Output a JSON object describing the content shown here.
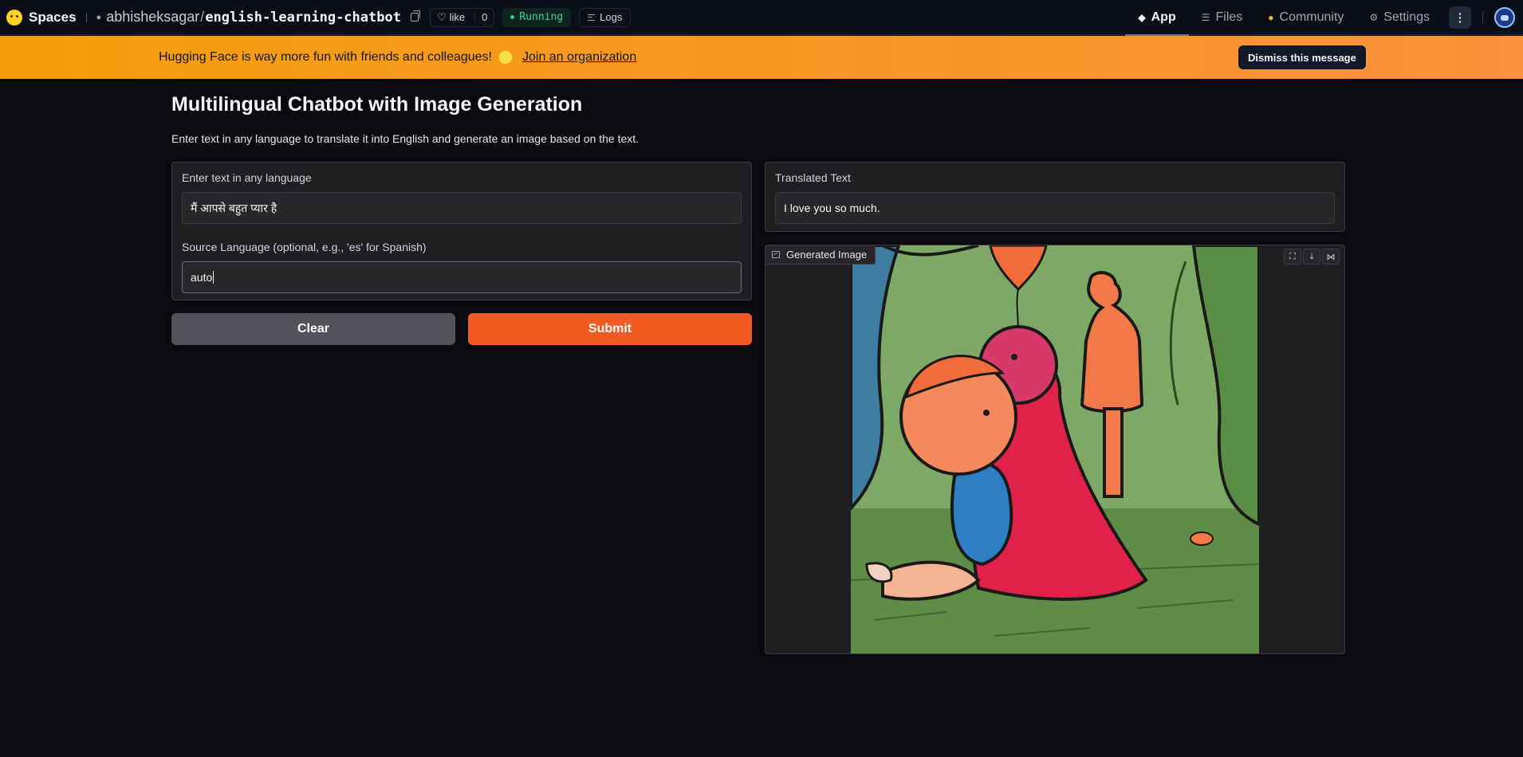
{
  "topnav": {
    "brand": "Spaces",
    "owner": "abhisheksagar",
    "slash": "/",
    "repo_name": "english-learning-chatbot",
    "like_label": "like",
    "like_count": "0",
    "status": "Running",
    "logs_label": "Logs",
    "tabs": [
      {
        "label": "App",
        "icon": "app-cube-icon",
        "active": true
      },
      {
        "label": "Files",
        "icon": "files-icon",
        "active": false
      },
      {
        "label": "Community",
        "icon": "community-icon",
        "active": false
      },
      {
        "label": "Settings",
        "icon": "gear-icon",
        "active": false
      }
    ],
    "more_glyph": "⋮"
  },
  "banner": {
    "message": "Hugging Face is way more fun with friends and colleagues!",
    "join_label": "Join an organization",
    "dismiss_label": "Dismiss this message"
  },
  "app": {
    "title": "Multilingual Chatbot with Image Generation",
    "description": "Enter text in any language to translate it into English and generate an image based on the text.",
    "input_label": "Enter text in any language",
    "input_value": "मैं आपसे बहुत प्यार है",
    "source_label": "Source Language (optional, e.g., 'es' for Spanish)",
    "source_value": "auto",
    "clear_label": "Clear",
    "submit_label": "Submit",
    "translated_label": "Translated Text",
    "translated_value": "I love you so much.",
    "image_label": "Generated Image"
  },
  "colors": {
    "accent": "#f25a22",
    "banner": "#f59e0b",
    "status": "#34d399"
  }
}
